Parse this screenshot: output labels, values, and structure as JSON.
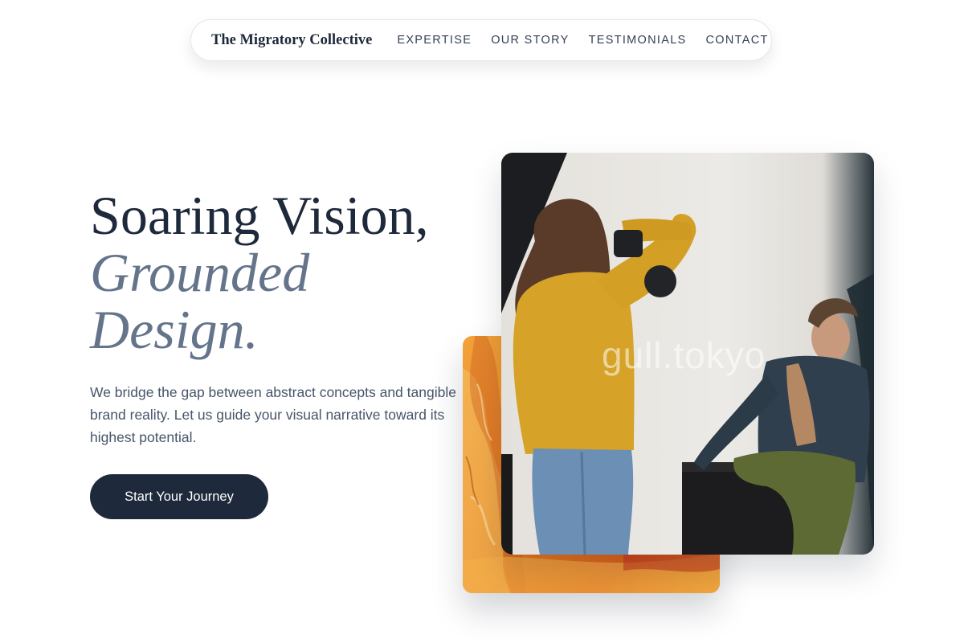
{
  "nav": {
    "brand": "The Migratory Collective",
    "links": [
      {
        "label": "EXPERTISE"
      },
      {
        "label": "OUR STORY"
      },
      {
        "label": "TESTIMONIALS"
      },
      {
        "label": "CONTACT"
      }
    ]
  },
  "hero": {
    "headline_line1": "Soaring Vision,",
    "headline_line2": "Grounded",
    "headline_line3": "Design.",
    "description": "We bridge the gap between abstract concepts and tangible brand reality. Let us guide your visual narrative toward its highest potential.",
    "cta_label": "Start Your Journey"
  },
  "images": {
    "photo_watermark": "gull.tokyo"
  },
  "colors": {
    "primary": "#1e293b",
    "muted": "#64748b",
    "body_text": "#475569",
    "accent_paint": "#e8821e"
  }
}
